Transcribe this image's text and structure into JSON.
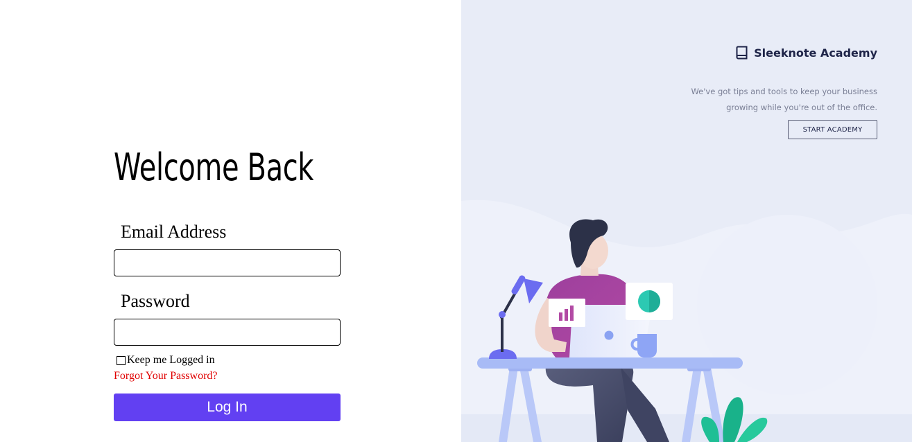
{
  "login": {
    "title": "Welcome Back",
    "email_label": "Email Address",
    "email_value": "",
    "password_label": "Password",
    "password_value": "",
    "keep_logged_in_label": "Keep me Logged in",
    "keep_logged_in_checked": false,
    "forgot_password_label": "Forgot Your Password?",
    "login_button_label": "Log In",
    "accent_color": "#6240f2",
    "link_color": "#e00000"
  },
  "promo": {
    "brand_icon": "book-icon",
    "brand_name": "Sleeknote Academy",
    "tagline_line1": "We've got tips and tools to keep your business",
    "tagline_line2": "growing while you're out of the office.",
    "cta_label": "START ACADEMY",
    "background_color": "#e8ecf7",
    "illustration": "person-working-at-desk-illustration"
  }
}
